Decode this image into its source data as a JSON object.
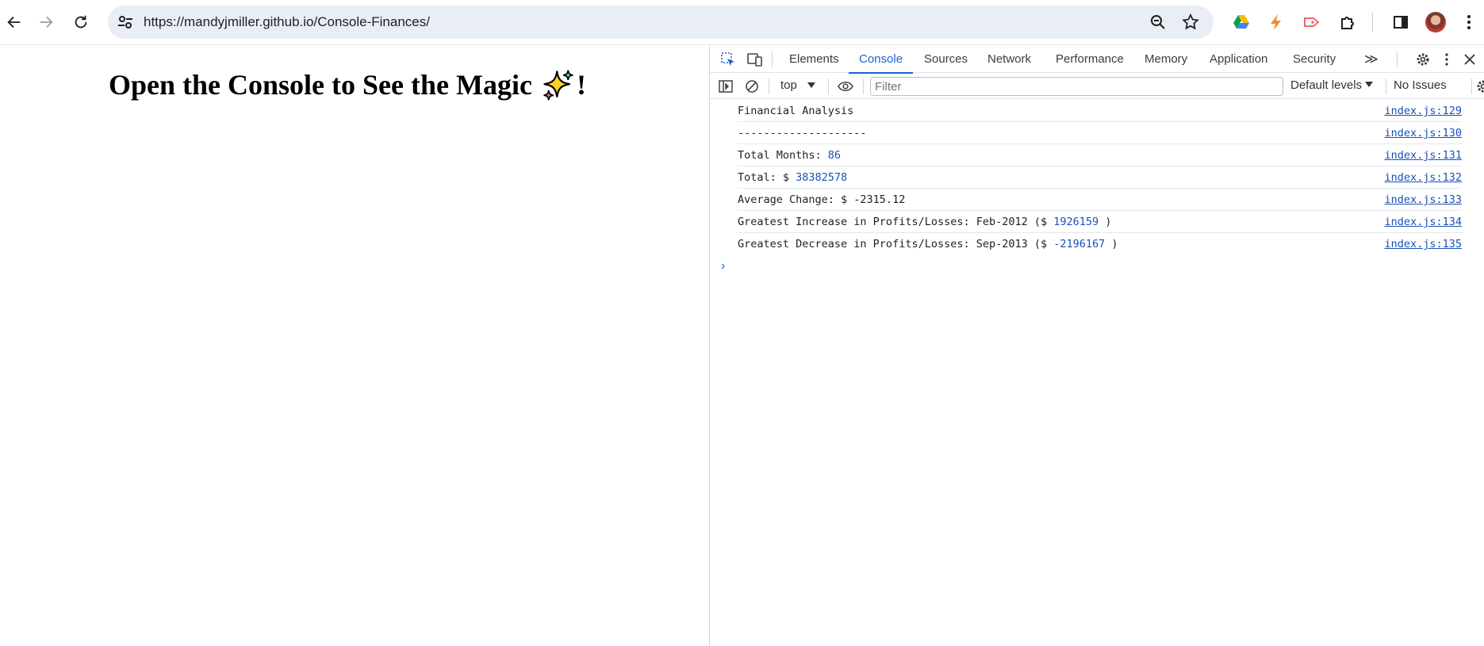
{
  "browser": {
    "url": "https://mandyjmiller.github.io/Console-Finances/"
  },
  "page": {
    "heading_before": "Open the Console to See the Magic",
    "heading_after": "!"
  },
  "devtools": {
    "tabs": [
      "Elements",
      "Console",
      "Sources",
      "Network",
      "Performance",
      "Memory",
      "Application",
      "Security"
    ],
    "more_tabs": "≫",
    "active_tab": "Console",
    "context": "top",
    "filter_placeholder": "Filter",
    "levels": "Default levels",
    "issues": "No Issues",
    "prompt": "›",
    "logs": [
      {
        "text": "Financial Analysis",
        "value": "",
        "suffix": "",
        "source": "index.js:129"
      },
      {
        "text": "--------------------",
        "value": "",
        "suffix": "",
        "source": "index.js:130"
      },
      {
        "text": "Total Months: ",
        "value": "86",
        "suffix": "",
        "source": "index.js:131"
      },
      {
        "text": "Total: $ ",
        "value": "38382578",
        "suffix": "",
        "source": "index.js:132"
      },
      {
        "text": "Average Change: $ -2315.12",
        "value": "",
        "suffix": "",
        "source": "index.js:133"
      },
      {
        "text": "Greatest Increase in Profits/Losses: Feb-2012 ($ ",
        "value": "1926159",
        "suffix": " )",
        "source": "index.js:134"
      },
      {
        "text": "Greatest Decrease in Profits/Losses: Sep-2013 ($ ",
        "value": "-2196167",
        "suffix": " )",
        "source": "index.js:135"
      }
    ]
  },
  "colors": {
    "accent": "#1a62d2",
    "number": "#1a4fb8"
  }
}
